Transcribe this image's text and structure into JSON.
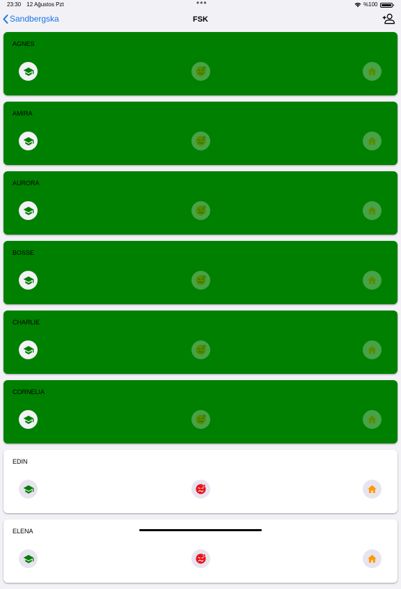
{
  "status": {
    "time": "23:30",
    "date": "12 Ağustos Pzt",
    "battery": "%100",
    "wifi_icon": "wifi-icon",
    "battery_icon": "battery-icon"
  },
  "nav": {
    "back_label": "Sandbergska",
    "title": "FSK",
    "add_icon": "add-person-icon"
  },
  "colors": {
    "present": "#008000",
    "card_light": "#ffffff",
    "accent_blue": "#1a73e8",
    "school_icon": "#008000",
    "sick_active": "#e8141c",
    "home_active": "#ff9900",
    "inactive_icon": "#5c8a00"
  },
  "students": [
    {
      "name": "AGNES",
      "state": "school"
    },
    {
      "name": "AMIRA",
      "state": "school"
    },
    {
      "name": "AURORA",
      "state": "school"
    },
    {
      "name": "BOSSE",
      "state": "school"
    },
    {
      "name": "CHARLIE",
      "state": "school"
    },
    {
      "name": "CORNELIA",
      "state": "school"
    },
    {
      "name": "EDIN",
      "state": "none"
    },
    {
      "name": "ELENA",
      "state": "none"
    }
  ]
}
